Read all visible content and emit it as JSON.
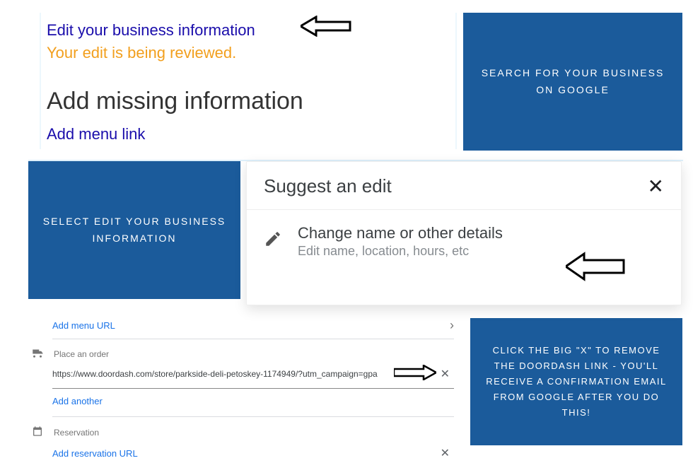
{
  "annotations": {
    "search": "SEARCH FOR YOUR BUSINESS ON GOOGLE",
    "select": "SELECT EDIT YOUR BUSINESS INFORMATION",
    "click": "CLICK THE BIG \"X\" TO REMOVE THE DOORDASH LINK - YOU'LL RECEIVE A CONFIRMATION EMAIL FROM GOOGLE AFTER YOU DO THIS!"
  },
  "topPanel": {
    "editLink": "Edit your business information",
    "reviewLine": "Your edit is being reviewed.",
    "addMissing": "Add missing information",
    "addMenu": "Add menu link"
  },
  "suggestPanel": {
    "title": "Suggest an edit",
    "closeLabel": "✕",
    "option": {
      "title": "Change name or other details",
      "subtitle": "Edit name, location, hours, etc"
    }
  },
  "urlsPanel": {
    "addMenuUrl": "Add menu URL",
    "placeOrderLabel": "Place an order",
    "orderUrl": "https://www.doordash.com/store/parkside-deli-petoskey-1174949/?utm_campaign=gpa",
    "addAnother": "Add another",
    "reservationLabel": "Reservation",
    "addReservationUrl": "Add reservation URL"
  }
}
